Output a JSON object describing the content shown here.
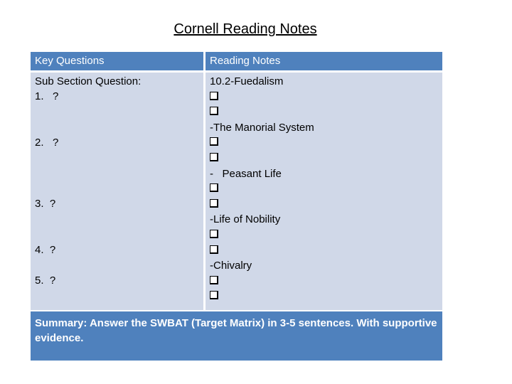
{
  "title": "Cornell Reading Notes",
  "table": {
    "headers": [
      "Key Questions",
      "Reading Notes"
    ],
    "key_questions": {
      "intro": "Sub Section Question:",
      "items": [
        "1.   ?",
        "2.   ?",
        "3.  ?",
        "4.  ?",
        "5.  ?"
      ]
    },
    "reading_notes": [
      {
        "type": "text",
        "text": "10.2-Fuedalism"
      },
      {
        "type": "checkbox"
      },
      {
        "type": "checkbox"
      },
      {
        "type": "text",
        "text": "-The Manorial System"
      },
      {
        "type": "checkbox"
      },
      {
        "type": "checkbox"
      },
      {
        "type": "text",
        "text": "-   Peasant Life"
      },
      {
        "type": "checkbox"
      },
      {
        "type": "checkbox"
      },
      {
        "type": "text",
        "text": "-Life of Nobility"
      },
      {
        "type": "checkbox"
      },
      {
        "type": "checkbox"
      },
      {
        "type": "text",
        "text": "-Chivalry"
      },
      {
        "type": "checkbox"
      },
      {
        "type": "checkbox"
      }
    ],
    "summary": "Summary: Answer the SWBAT (Target Matrix) in 3-5 sentences. With supportive evidence."
  },
  "colors": {
    "header": "#4f81bd",
    "body": "#d0d8e8"
  }
}
